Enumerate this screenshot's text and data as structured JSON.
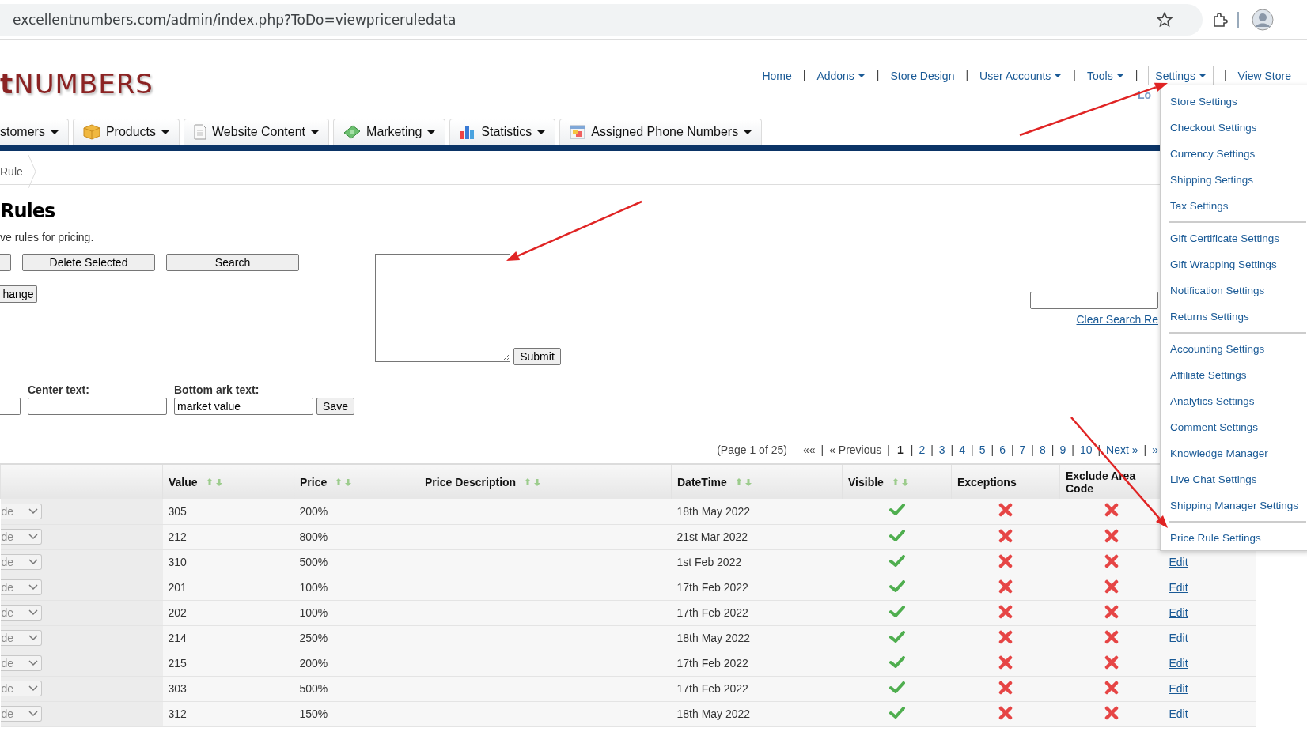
{
  "browser": {
    "url": "excellentnumbers.com/admin/index.php?ToDo=viewpriceruledata"
  },
  "logo": "**t**NUMBERS",
  "top_nav": [
    {
      "label": "Home",
      "dropdown": false,
      "expanded": false
    },
    {
      "label": "Addons",
      "dropdown": true,
      "expanded": false,
      "separator_before": "|"
    },
    {
      "label": "Store Design",
      "dropdown": false,
      "expanded": false,
      "separator_before": "|"
    },
    {
      "label": "User Accounts",
      "dropdown": true,
      "expanded": false,
      "separator_before": "|"
    },
    {
      "label": "Tools",
      "dropdown": true,
      "expanded": false,
      "separator_before": "|"
    },
    {
      "label": "Settings",
      "dropdown": true,
      "expanded": true,
      "separator_before": "|"
    },
    {
      "label": "View Store",
      "dropdown": false,
      "expanded": false,
      "separator_before": "|"
    }
  ],
  "nav_subtext": "Lo",
  "settings_menu": {
    "groups": [
      {
        "items": [
          "Store Settings",
          "Checkout Settings",
          "Currency Settings",
          "Shipping Settings",
          "Tax Settings"
        ]
      },
      {
        "items": [
          "Gift Certificate Settings",
          "Gift Wrapping Settings",
          "Notification Settings",
          "Returns Settings"
        ]
      },
      {
        "items": [
          "Accounting Settings",
          "Affiliate Settings",
          "Analytics Settings",
          "Comment Settings",
          "Knowledge Manager",
          "Live Chat Settings",
          "Shipping Manager Settings"
        ]
      },
      {
        "items": [
          "Price Rule Settings"
        ]
      }
    ]
  },
  "main_tabs": [
    {
      "label": "stomers"
    },
    {
      "label": "Products"
    },
    {
      "label": "Website Content"
    },
    {
      "label": "Marketing"
    },
    {
      "label": "Statistics"
    },
    {
      "label": "Assigned Phone Numbers"
    }
  ],
  "breadcrumb": "Rule",
  "heading": "Rules",
  "description": "ve rules for pricing.",
  "action_buttons": [
    "Delete Selected",
    "Search"
  ],
  "change_button": "hange",
  "submit_button": "Submit",
  "clear_search_link": "Clear Search Re",
  "text_fields": [
    {
      "label": "Center text:"
    },
    {
      "label": "Bottom ark text:",
      "value": "market value"
    }
  ],
  "save_button": "Save",
  "pagination": [
    {
      "label": "(Page 1 of 25)",
      "kind": "info"
    },
    {
      "label": "««",
      "kind": "text",
      "separator_after": "|"
    },
    {
      "label": "« Previous",
      "kind": "text",
      "separator_after": "|"
    },
    {
      "label": "1",
      "kind": "current",
      "separator_after": "|"
    },
    {
      "label": "2",
      "kind": "link",
      "separator_after": "|"
    },
    {
      "label": "3",
      "kind": "link",
      "separator_after": "|"
    },
    {
      "label": "4",
      "kind": "link",
      "separator_after": "|"
    },
    {
      "label": "5",
      "kind": "link",
      "separator_after": "|"
    },
    {
      "label": "6",
      "kind": "link",
      "separator_after": "|"
    },
    {
      "label": "7",
      "kind": "link",
      "separator_after": "|"
    },
    {
      "label": "8",
      "kind": "link",
      "separator_after": "|"
    },
    {
      "label": "9",
      "kind": "link",
      "separator_after": "|"
    },
    {
      "label": "10",
      "kind": "link",
      "separator_after": "|"
    },
    {
      "label": "Next »",
      "kind": "link",
      "separator_after": "|"
    },
    {
      "label": "»",
      "kind": "link"
    }
  ],
  "table": {
    "columns": [
      {
        "sortable": false
      },
      {
        "label": "Value",
        "sortable": true
      },
      {
        "label": "Price",
        "sortable": true
      },
      {
        "label": "Price Description",
        "sortable": true
      },
      {
        "label": "DateTime",
        "sortable": true
      },
      {
        "label": "Visible",
        "sortable": true
      },
      {
        "label": "Exceptions",
        "sortable": false
      },
      {
        "label": "Exclude Area Code",
        "sortable": false
      }
    ],
    "rows": [
      {
        "type_select": "de",
        "value": "305",
        "price": "200%",
        "datetime": "18th May 2022",
        "visible": true,
        "exceptions": false,
        "exclude_area_code": false
      },
      {
        "type_select": "de",
        "value": "212",
        "price": "800%",
        "datetime": "21st Mar 2022",
        "visible": true,
        "exceptions": false,
        "exclude_area_code": false
      },
      {
        "type_select": "de",
        "value": "310",
        "price": "500%",
        "datetime": "1st Feb 2022",
        "visible": true,
        "exceptions": false,
        "exclude_area_code": false,
        "edit": "Edit"
      },
      {
        "type_select": "de",
        "value": "201",
        "price": "100%",
        "datetime": "17th Feb 2022",
        "visible": true,
        "exceptions": false,
        "exclude_area_code": false,
        "edit": "Edit"
      },
      {
        "type_select": "de",
        "value": "202",
        "price": "100%",
        "datetime": "17th Feb 2022",
        "visible": true,
        "exceptions": false,
        "exclude_area_code": false,
        "edit": "Edit"
      },
      {
        "type_select": "de",
        "value": "214",
        "price": "250%",
        "datetime": "18th May 2022",
        "visible": true,
        "exceptions": false,
        "exclude_area_code": false,
        "edit": "Edit"
      },
      {
        "type_select": "de",
        "value": "215",
        "price": "200%",
        "datetime": "17th Feb 2022",
        "visible": true,
        "exceptions": false,
        "exclude_area_code": false,
        "edit": "Edit"
      },
      {
        "type_select": "de",
        "value": "303",
        "price": "500%",
        "datetime": "17th Feb 2022",
        "visible": true,
        "exceptions": false,
        "exclude_area_code": false,
        "edit": "Edit"
      },
      {
        "type_select": "de",
        "value": "312",
        "price": "150%",
        "datetime": "18th May 2022",
        "visible": true,
        "exceptions": false,
        "exclude_area_code": false,
        "edit": "Edit"
      }
    ]
  }
}
